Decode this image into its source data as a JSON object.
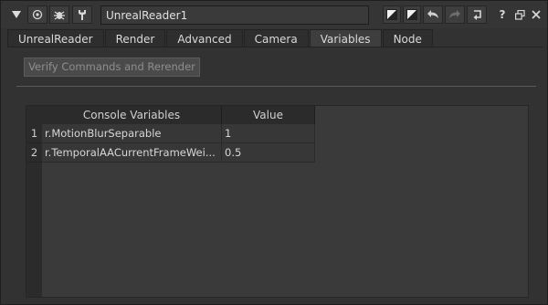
{
  "node": {
    "name": "UnrealReader1"
  },
  "icons": {
    "collapse": "triangle-down-icon",
    "center": "target-icon",
    "bug": "bug-icon",
    "wrench": "wrench-icon",
    "colors": [
      "half-color-icon",
      "half-color-icon-2"
    ],
    "undo": "undo-icon",
    "redo": "redo-icon",
    "revert": "revert-icon",
    "help": "help-icon",
    "float": "float-icon",
    "close": "close-icon"
  },
  "tabs": [
    {
      "label": "UnrealReader",
      "active": false
    },
    {
      "label": "Render",
      "active": false
    },
    {
      "label": "Advanced",
      "active": false
    },
    {
      "label": "Camera",
      "active": false
    },
    {
      "label": "Variables",
      "active": true
    },
    {
      "label": "Node",
      "active": false
    }
  ],
  "variables_tab": {
    "verify_button": "Verify Commands and Rerender",
    "table": {
      "headers": [
        "Console Variables",
        "Value"
      ],
      "rows": [
        {
          "index": "1",
          "name": "r.MotionBlurSeparable",
          "value": "1"
        },
        {
          "index": "2",
          "name": "r.TemporalAACurrentFrameWei...",
          "value": "0.5"
        }
      ]
    }
  },
  "colors": {
    "background": "#323232",
    "panel_dark": "#2b2b2b",
    "text": "#d0d0d0"
  }
}
